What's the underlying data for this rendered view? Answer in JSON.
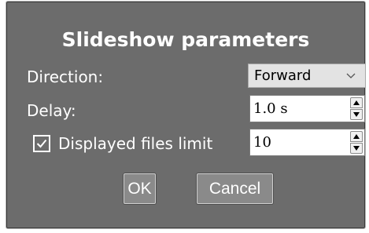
{
  "dialog": {
    "title": "Slideshow parameters",
    "direction": {
      "label": "Direction:",
      "value": "Forward"
    },
    "delay": {
      "label": "Delay:",
      "value": "1.0 s"
    },
    "files_limit": {
      "label": "Displayed files limit",
      "checked": true,
      "value": "10"
    },
    "buttons": {
      "ok": "OK",
      "cancel": "Cancel"
    }
  },
  "colors": {
    "dialog_background": "#6c6c6c",
    "text": "#ffffff",
    "button_background": "#8a8a8a"
  },
  "icons": {
    "select_arrow": "chevron-down-icon",
    "spin_up": "spin-up-arrow-icon",
    "spin_down": "spin-down-arrow-icon",
    "checkbox_mark": "checkmark-icon"
  }
}
